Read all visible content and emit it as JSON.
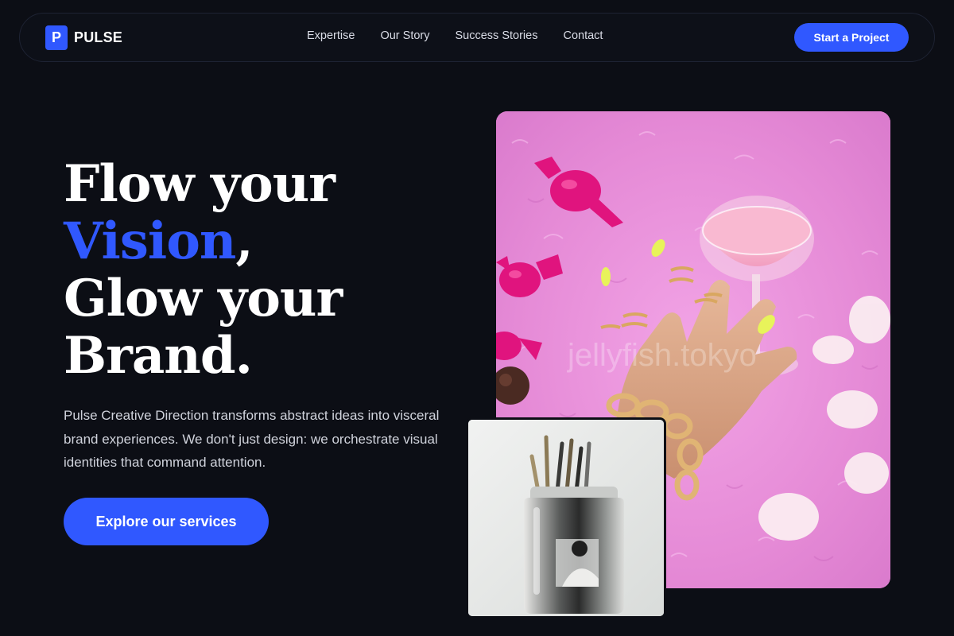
{
  "nav": {
    "logo_letter": "P",
    "brand": "PULSE",
    "links": [
      "Expertise",
      "Our Story",
      "Success Stories",
      "Contact"
    ],
    "cta": "Start a Project"
  },
  "hero": {
    "headline_line1": "Flow your",
    "headline_accent": "Vision",
    "headline_comma": ",",
    "headline_line3": "Glow your",
    "headline_line4": "Brand.",
    "description": "Pulse Creative Direction transforms abstract ideas into visceral brand experiences. We don't just design: we orchestrate visual identities that command attention.",
    "cta": "Explore our services"
  },
  "media": {
    "main_image_watermark": "jellyfish.tokyo",
    "main_image_subject": "hand-with-cocktail-glass-on-pink-fur",
    "small_image_subject": "paintbrushes-in-glass-jar"
  },
  "colors": {
    "background": "#0c0e15",
    "accent": "#3058ff",
    "pink": "#e58ad6"
  }
}
